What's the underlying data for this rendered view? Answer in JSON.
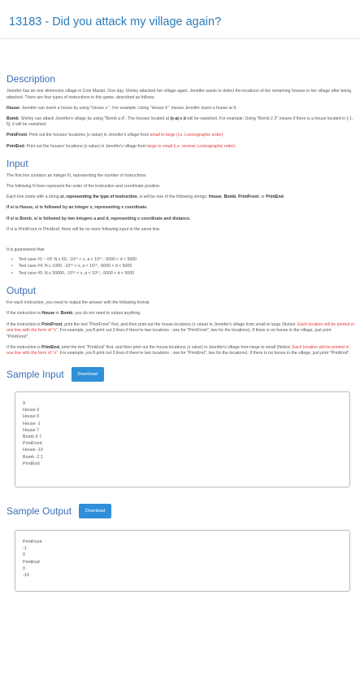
{
  "page": {
    "title": "13183 - Did you attack my village again?"
  },
  "description": {
    "heading": "Description",
    "intro": "Jennifer has an one dimension village in Coin Master. One day, Shirley attacked her village again. Jennifer wants to detect the locations of the remaining houses in her village after being attacked. There are four types of instructions in this game, described as follows.",
    "house_label": "House",
    "house_text": ": Jennifer can insert a house by using \"House x \". For example: Using \"House 9 \" means Jennifer insert a house at 9.",
    "bomb_label": "Bomb",
    "bomb_text_a": ": Shirley can attack Jennifer's village by using \"Bomb a d\". The houses located at ",
    "bomb_highlight": "|x-a| ≤ d",
    "bomb_text_b": " will be vanished. For example: Using \"Bomb 2 3\" means if there is a house located in [-1, 5], it will be vanished.",
    "pf_label": "PrintFront",
    "pf_text": ": Print out the houses' locations (x value) in Jennifer's village from ",
    "pf_red": "small to large  (i.e. Lexicographic order)",
    "pe_label": "PrintEnd",
    "pe_text": ": Print out the houses' locations (x value) in Jennifer's village from ",
    "pe_red": "large to small  (i.e. reverse Lexicographic order)"
  },
  "input": {
    "heading": "Input",
    "line1": "The first line contains an integer N, representing the number of instructions",
    "line2": "The following N lines represent the order of the instruction and coordinate position.",
    "line3_a": "Each line starts with a string ",
    "line3_si": "si",
    "line3_bold": ", representing the type of instruction. ",
    "line3_b": "si",
    "line3_c": " will be one of the following strings: ",
    "line3_s1": "House",
    "line3_sep1": ", ",
    "line3_s2": "Bomb",
    "line3_sep2": ", ",
    "line3_s3": "PrintFront",
    "line3_sep3": ", or ",
    "line3_s4": "PrintEnd",
    "line3_end": ".",
    "line4": "If si is House, si is followed by an integer x, representing x coordinate.",
    "line5": "If si is Bomb, si is followed by two integers a and d, representing x coordinate and distance.",
    "line6": "If si is PrintFront or PrintEnd, there will be no more following input in the same line.",
    "guarantee": "It is guaranteed that:",
    "cases": [
      "Test case #1 ~ #3: N ≤ 60,   -10¹⁰ < x, a < 10¹⁰, -5000 < d < 5000",
      "Test case #4: N ≤ 1000,   -10¹⁰ < x, a < 10¹⁰, -5000 < d < 5000",
      "Test case #5: N ≤ 30000,   -10¹⁰ < x, a < 10¹⁰, -5000 < d < 5000"
    ]
  },
  "output": {
    "heading": "Output",
    "line1": "For each instruction, you need to output the answer with the following format.",
    "line2_a": "If the instruction is ",
    "line2_h": "House",
    "line2_b": " or ",
    "line2_bm": "Bomb",
    "line2_c": ", you do not need to output anything.",
    "line3_a": "If the instruction is ",
    "line3_kw": "PrintFront",
    "line3_b": ", print the text \"PrintFront\" first, and then print out the house locations (x value) in Jennifer's village from small to large (Notice: ",
    "line3_red": "Each location will be printed in one line with the form of \"x\".",
    "line3_c": " For example, you'll print out 3 lines if there're two locations - one for \"PrintFront\", two for the locations). If there is no house in the village, just print \"PrintFront\".",
    "line4_a": "If the instruction is ",
    "line4_kw": "PrintEnd",
    "line4_b": ", print the text \"PrintEnd\" first, and then print out the house locations (x value) in Jennifer's village from large to small (Notice: ",
    "line4_red": "Each location will be printed in one line with the form of \"x\".",
    "line4_c": " For example, you'll print out 3 lines if there're two locations - one for \"PrintEnd\", two for the locations). If there is no house in the village, just print \"PrintEnd\"."
  },
  "sample_input": {
    "heading": "Sample Input",
    "download_label": "Download",
    "lines": [
      "9",
      "House 3",
      "House 0",
      "House -1",
      "House 7",
      "Bomb 9 7",
      "PrintFront",
      "House -10",
      "Bomb -2 1",
      "PrintEnd"
    ]
  },
  "sample_output": {
    "heading": "Sample Output",
    "download_label": "Download",
    "lines": [
      "PrintFront",
      "-1",
      "0",
      "PrintEnd",
      "0",
      "-10"
    ]
  }
}
